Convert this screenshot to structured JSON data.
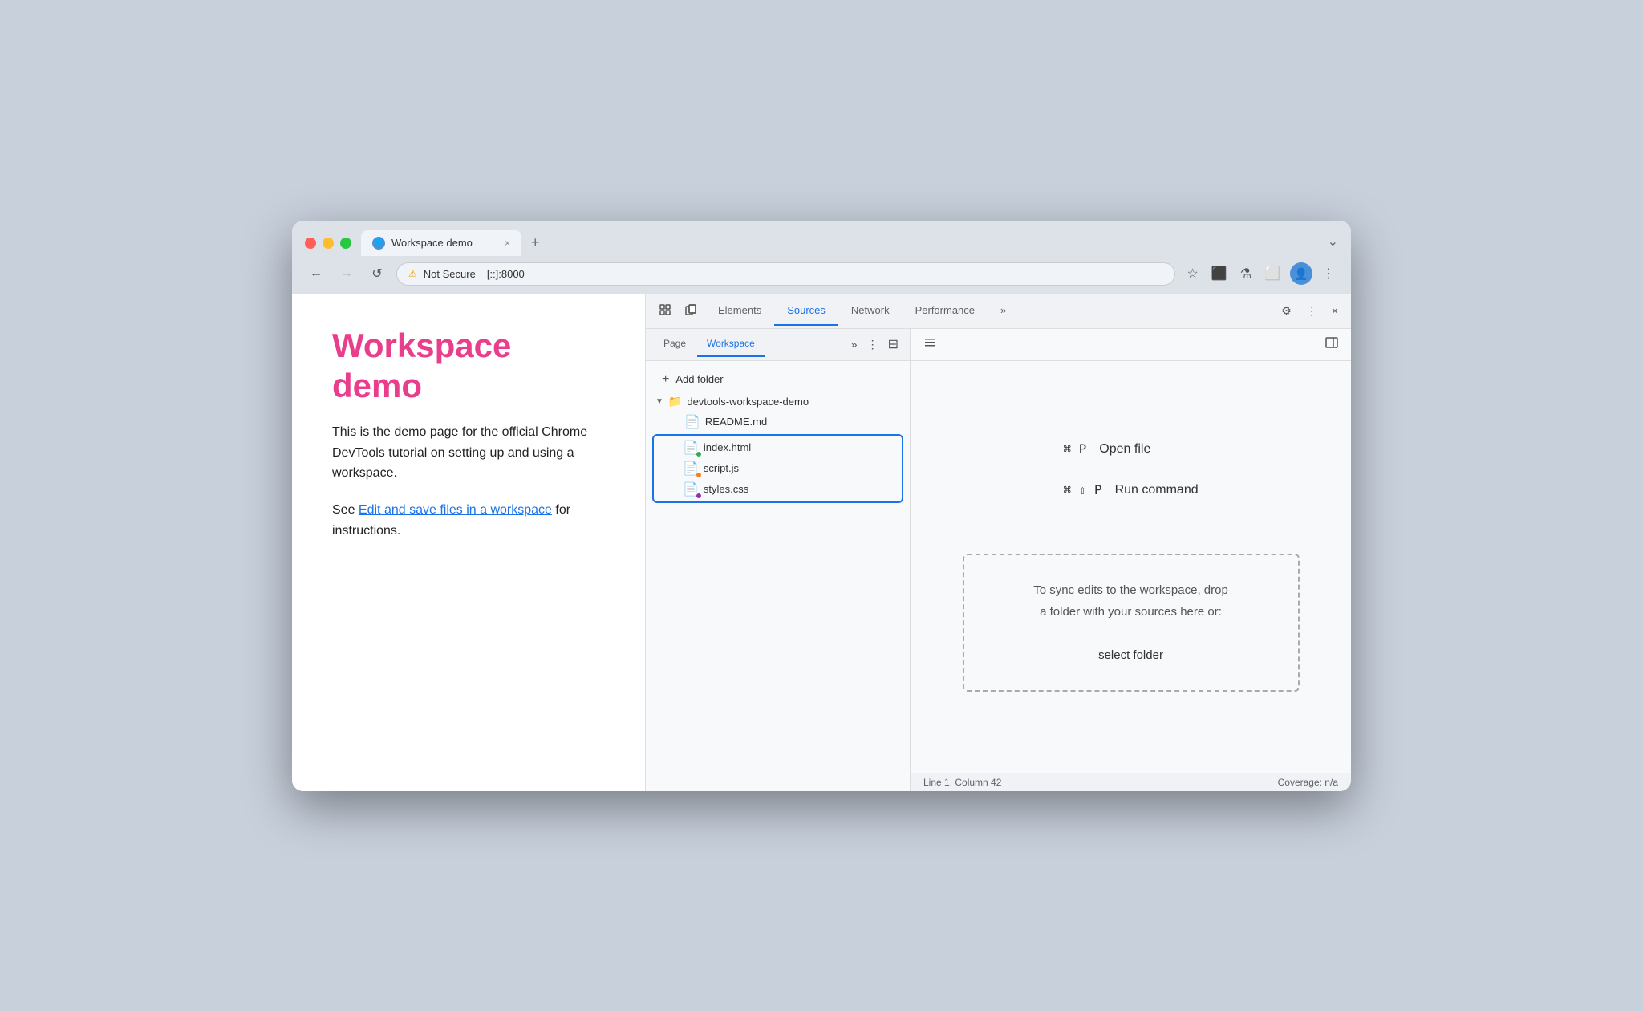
{
  "browser": {
    "tab": {
      "title": "Workspace demo",
      "favicon": "🌐",
      "close": "×"
    },
    "new_tab": "+",
    "tabs_arrow": "⌄",
    "address": {
      "warning": "⚠",
      "not_secure": "Not Secure",
      "url": "[::]:8000"
    },
    "nav": {
      "back": "←",
      "forward": "→",
      "reload": "↺"
    },
    "toolbar_icons": [
      "☆",
      "⬛",
      "⚗",
      "⬜",
      "👤",
      "⋮"
    ]
  },
  "page": {
    "title": "Workspace demo",
    "body1": "This is the demo page for the official Chrome DevTools tutorial on setting up and using a workspace.",
    "body2": "See ",
    "link_text": "Edit and save files in a workspace",
    "body3": " for instructions."
  },
  "devtools": {
    "tabs": [
      {
        "id": "elements",
        "label": "Elements",
        "active": false
      },
      {
        "id": "sources",
        "label": "Sources",
        "active": true
      },
      {
        "id": "network",
        "label": "Network",
        "active": false
      },
      {
        "id": "performance",
        "label": "Performance",
        "active": false
      }
    ],
    "more_tabs": "»",
    "settings_icon": "⚙",
    "more_icon": "⋮",
    "close_icon": "×",
    "inspect_icon": "⬚",
    "device_icon": "⬜",
    "panel_toggle": "◧",
    "panel_toggle_right": "◨",
    "sources": {
      "sub_tabs": [
        {
          "id": "page",
          "label": "Page",
          "active": false
        },
        {
          "id": "workspace",
          "label": "Workspace",
          "active": true
        }
      ],
      "more_tabs": "»",
      "more_options": "⋮",
      "toggle_sidebar": "⊟",
      "add_folder_label": "Add folder",
      "folder": {
        "name": "devtools-workspace-demo",
        "files": [
          {
            "name": "README.md",
            "dot": null
          },
          {
            "name": "index.html",
            "dot": "green"
          },
          {
            "name": "script.js",
            "dot": "orange"
          },
          {
            "name": "styles.css",
            "dot": "purple"
          }
        ]
      },
      "shortcuts": [
        {
          "keys": "⌘ P",
          "label": "Open file"
        },
        {
          "keys": "⌘ ⇧ P",
          "label": "Run command"
        }
      ],
      "drop_zone": {
        "line1": "To sync edits to the workspace, drop",
        "line2": "a folder with your sources here or:",
        "action": "select folder"
      },
      "status_bar": {
        "position": "Line 1, Column 42",
        "coverage": "Coverage: n/a"
      }
    }
  }
}
